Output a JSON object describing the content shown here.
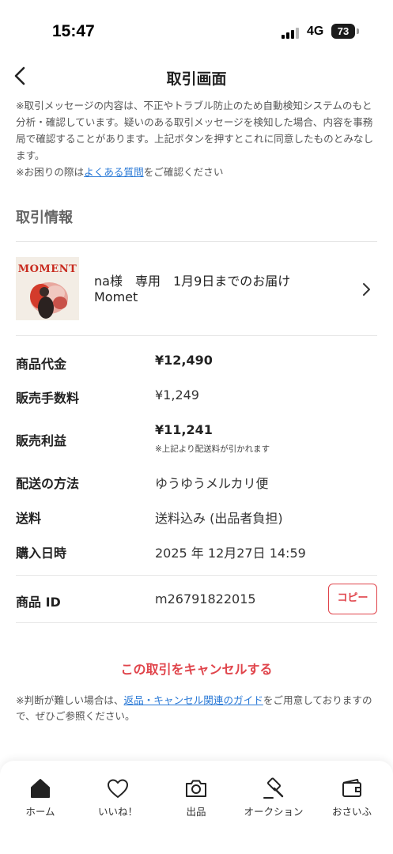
{
  "status_bar": {
    "time": "15:47",
    "network": "4G",
    "battery": "73"
  },
  "header": {
    "title": "取引画面"
  },
  "notice": {
    "line1": "※取引メッセージの内容は、不正やトラブル防止のため自動検知システムのもと分析・確認しています。疑いのある取引メッセージを検知した場合、内容を事務局で確認することがあります。上記ボタンを押すとこれに同意したものとみなします。",
    "line2_prefix": "※お困りの際は",
    "line2_link": "よくある質問",
    "line2_suffix": "をご確認ください"
  },
  "section_title": "取引情報",
  "item": {
    "thumbnail_text": "MOMENT",
    "title": "na様　専用　1月9日までのお届け",
    "subtitle": "Momet"
  },
  "info": {
    "price_label": "商品代金",
    "price_value": "¥12,490",
    "fee_label": "販売手数料",
    "fee_value": "¥1,249",
    "profit_label": "販売利益",
    "profit_value": "¥11,241",
    "profit_note": "※上記より配送料が引かれます",
    "shipping_method_label": "配送の方法",
    "shipping_method_value": "ゆうゆうメルカリ便",
    "shipping_fee_label": "送料",
    "shipping_fee_value": "送料込み (出品者負担)",
    "purchase_date_label": "購入日時",
    "purchase_date_value": "2025 年 12月27日 14:59",
    "item_id_label": "商品 ID",
    "item_id_value": "m26791822015",
    "copy_label": "コピー"
  },
  "cancel_label": "この取引をキャンセルする",
  "footnote": {
    "prefix": "※判断が難しい場合は、",
    "link": "返品・キャンセル関連のガイド",
    "suffix": "をご用意しておりますので、ぜひご参照ください。"
  },
  "tab_bar": {
    "home": "ホーム",
    "likes": "いいね！",
    "sell": "出品",
    "auction": "オークション",
    "wallet": "おさいふ"
  }
}
